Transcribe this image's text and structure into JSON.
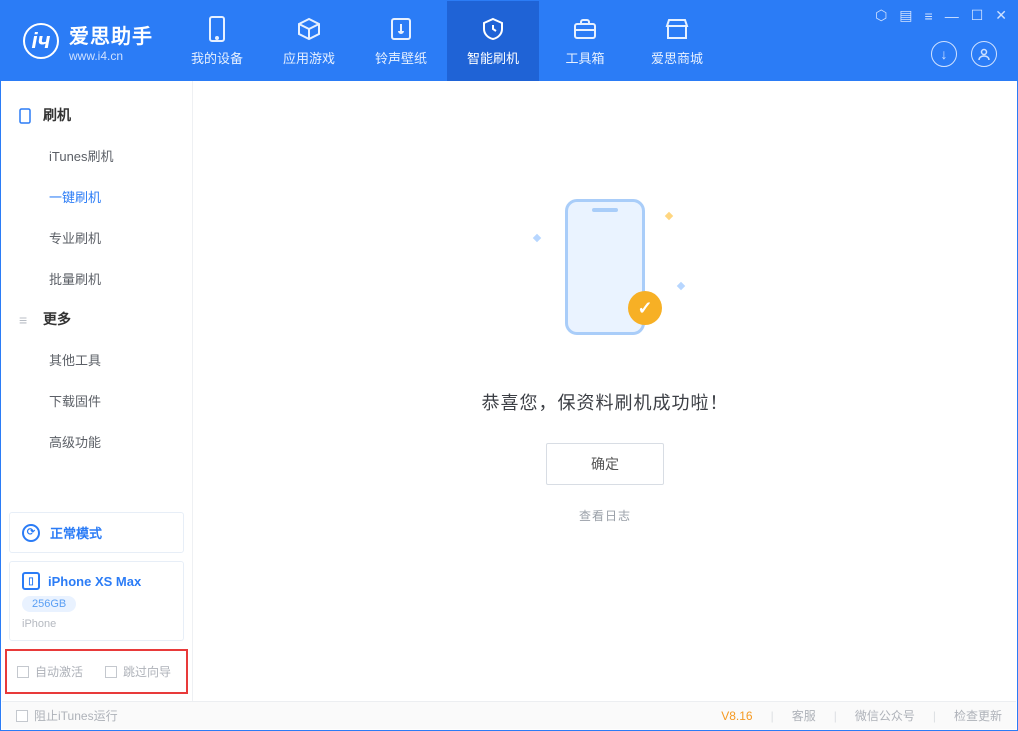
{
  "header": {
    "app_name": "爱思助手",
    "app_url": "www.i4.cn",
    "tabs": [
      {
        "label": "我的设备"
      },
      {
        "label": "应用游戏"
      },
      {
        "label": "铃声壁纸"
      },
      {
        "label": "智能刷机"
      },
      {
        "label": "工具箱"
      },
      {
        "label": "爱思商城"
      }
    ]
  },
  "sidebar": {
    "group1_title": "刷机",
    "group1_items": [
      {
        "label": "iTunes刷机"
      },
      {
        "label": "一键刷机"
      },
      {
        "label": "专业刷机"
      },
      {
        "label": "批量刷机"
      }
    ],
    "group2_title": "更多",
    "group2_items": [
      {
        "label": "其他工具"
      },
      {
        "label": "下载固件"
      },
      {
        "label": "高级功能"
      }
    ],
    "mode_label": "正常模式",
    "device_name": "iPhone XS Max",
    "device_capacity": "256GB",
    "device_type": "iPhone",
    "auto_activate": "自动激活",
    "skip_guide": "跳过向导"
  },
  "main": {
    "success_msg": "恭喜您，保资料刷机成功啦！",
    "ok_btn": "确定",
    "view_log": "查看日志"
  },
  "status": {
    "block_itunes": "阻止iTunes运行",
    "version": "V8.16",
    "customer_service": "客服",
    "wechat_account": "微信公众号",
    "check_update": "检查更新"
  }
}
